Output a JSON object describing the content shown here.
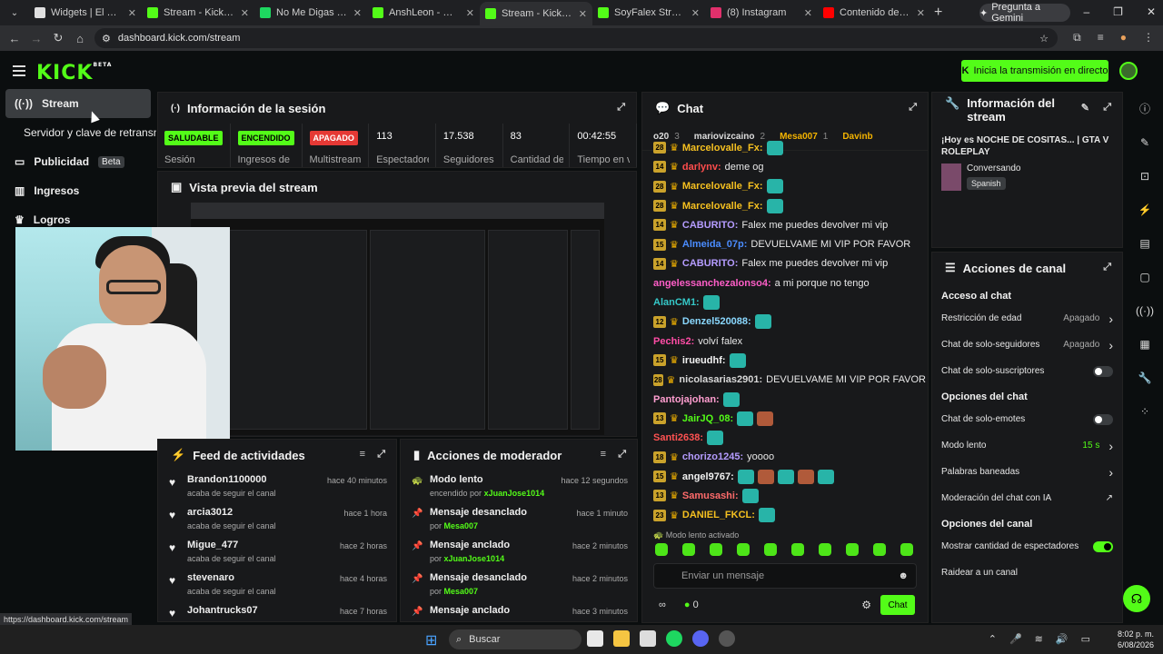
{
  "browser": {
    "tabs": [
      {
        "title": "Widgets | El mejor so",
        "color": "#e0e0e0"
      },
      {
        "title": "Stream - Kick Dashbo",
        "color": "#53fc18"
      },
      {
        "title": "No Me Digas Qu",
        "color": "#1ed760"
      },
      {
        "title": "AnshLeon - Watch cli",
        "color": "#53fc18"
      },
      {
        "title": "Stream - Kick Dashbo",
        "color": "#53fc18",
        "active": true
      },
      {
        "title": "SoyFalex Stream - W",
        "color": "#53fc18"
      },
      {
        "title": "(8) Instagram",
        "color": "#e1306c"
      },
      {
        "title": "Contenido del canal",
        "color": "#ff0000"
      }
    ],
    "gemini_label": "Pregunta a Gemini",
    "url": "dashboard.kick.com/stream"
  },
  "header": {
    "logo": "KICK",
    "logo_tag": "BETA",
    "cta_label": "Inicia la transmisión en directo"
  },
  "sidebar": {
    "items": [
      {
        "label": "Stream",
        "icon": "broadcast-icon"
      },
      {
        "label": "Servidor y clave de retransn",
        "icon": ""
      },
      {
        "label": "Publicidad",
        "icon": "ads-icon",
        "badge": "Beta"
      },
      {
        "label": "Ingresos",
        "icon": "revenue-icon"
      },
      {
        "label": "Logros",
        "icon": "trophy-icon"
      }
    ]
  },
  "session": {
    "title": "Información de la sesión",
    "stats": [
      {
        "value": "SALUDABLE",
        "label": "Sesión",
        "pill": "#53fc18"
      },
      {
        "value": "ENCENDIDO",
        "label": "Ingresos de",
        "pill": "#53fc18"
      },
      {
        "value": "APAGADO",
        "label": "Multistream",
        "pill": "#e53935"
      },
      {
        "value": "113",
        "label": "Espectadores"
      },
      {
        "value": "17.538",
        "label": "Seguidores"
      },
      {
        "value": "83",
        "label": "Cantidad de suscripciones"
      },
      {
        "value": "00:42:55",
        "label": "Tiempo en vivo"
      }
    ]
  },
  "preview": {
    "title": "Vista previa del stream"
  },
  "feed": {
    "title": "Feed de actividades",
    "items": [
      {
        "name": "Brandon1100000",
        "sub": "acaba de seguir el canal",
        "time": "hace 40 minutos"
      },
      {
        "name": "arcia3012",
        "sub": "acaba de seguir el canal",
        "time": "hace 1 hora"
      },
      {
        "name": "Migue_477",
        "sub": "acaba de seguir el canal",
        "time": "hace 2 horas"
      },
      {
        "name": "stevenaro",
        "sub": "acaba de seguir el canal",
        "time": "hace 4 horas"
      },
      {
        "name": "Johantrucks07",
        "sub": "",
        "time": "hace 7 horas"
      }
    ]
  },
  "mod": {
    "title": "Acciones de moderador",
    "items": [
      {
        "action": "Modo lento",
        "prefix": "encendido por",
        "user": "xJuanJose1014",
        "time": "hace 12 segundos"
      },
      {
        "action": "Mensaje desanclado",
        "prefix": "por",
        "user": "Mesa007",
        "time": "hace 1 minuto"
      },
      {
        "action": "Mensaje anclado",
        "prefix": "por",
        "user": "xJuanJose1014",
        "time": "hace 2 minutos"
      },
      {
        "action": "Mensaje desanclado",
        "prefix": "por",
        "user": "Mesa007",
        "time": "hace 2 minutos"
      },
      {
        "action": "Mensaje anclado",
        "prefix": "",
        "user": "",
        "time": "hace 3 minutos"
      }
    ]
  },
  "chat": {
    "title": "Chat",
    "top_users": [
      {
        "name": "o20",
        "count": "3"
      },
      {
        "name": "mariovizcaino",
        "count": "2"
      },
      {
        "name": "Mesa007",
        "count": "1"
      },
      {
        "name": "Davinb",
        "count": ""
      }
    ],
    "messages": [
      {
        "badge": "28",
        "user": "Marcelovalle_Fx:",
        "color": "#f5c020",
        "text": "",
        "emotes": 1
      },
      {
        "badge": "14",
        "user": "darlynv:",
        "color": "#ff4d4d",
        "text": "deme og",
        "emotes": 0
      },
      {
        "badge": "28",
        "user": "Marcelovalle_Fx:",
        "color": "#f5c020",
        "text": "",
        "emotes": 1
      },
      {
        "badge": "28",
        "user": "Marcelovalle_Fx:",
        "color": "#f5c020",
        "text": "",
        "emotes": 1
      },
      {
        "badge": "14",
        "user": "CABURITO:",
        "color": "#b59cff",
        "text": "Falex me puedes devolver mi vip",
        "emotes": 0
      },
      {
        "badge": "15",
        "user": "Almeida_07p:",
        "color": "#4a8cff",
        "text": "DEVUELVAME MI VIP POR FAVOR",
        "emotes": 0
      },
      {
        "badge": "14",
        "user": "CABURITO:",
        "color": "#b59cff",
        "text": "Falex me puedes devolver mi vip",
        "emotes": 0
      },
      {
        "badge": "",
        "user": "angelessanchezalonso4:",
        "color": "#ff5ec8",
        "text": "a mi porque no tengo",
        "emotes": 0
      },
      {
        "badge": "",
        "user": "AlanCM1:",
        "color": "#35c8c8",
        "text": "",
        "emotes": 1
      },
      {
        "badge": "12",
        "user": "Denzel520088:",
        "color": "#8ad8ff",
        "text": "",
        "emotes": 1
      },
      {
        "badge": "",
        "user": "Pechis2:",
        "color": "#ff4da6",
        "text": "volví falex",
        "emotes": 0
      },
      {
        "badge": "15",
        "user": "irueudhf:",
        "color": "#f2f2f2",
        "text": "",
        "emotes": 1
      },
      {
        "badge": "28",
        "user": "nicolasarias2901:",
        "color": "#d8d8d8",
        "text": "DEVUELVAME MI VIP POR FAVOR",
        "emotes": 0
      },
      {
        "badge": "",
        "user": "Pantojajohan:",
        "color": "#ff9ed0",
        "text": "",
        "emotes": 1
      },
      {
        "badge": "13",
        "user": "JairJQ_08:",
        "color": "#53fc18",
        "text": "",
        "emotes": 2
      },
      {
        "badge": "",
        "user": "Santi2638:",
        "color": "#ff5252",
        "text": "",
        "emotes": 1
      },
      {
        "badge": "18",
        "user": "chorizo1245:",
        "color": "#b59cff",
        "text": "yoooo",
        "emotes": 0
      },
      {
        "badge": "15",
        "user": "angel9767:",
        "color": "#f2f2f2",
        "text": "",
        "emotes": 5
      },
      {
        "badge": "13",
        "user": "Samusashi:",
        "color": "#ff6b6b",
        "text": "",
        "emotes": 1
      },
      {
        "badge": "23",
        "user": "DANIEL_FKCL:",
        "color": "#f5c020",
        "text": "",
        "emotes": 1
      }
    ],
    "slow_mode": "Modo lento activado",
    "input_placeholder": "Enviar un mensaje",
    "points": "0",
    "send_label": "Chat"
  },
  "stream_info": {
    "title": "Información del stream",
    "stream_title": "¡Hoy es NOCHE DE COSITAS... | GTA V ROLEPLAY",
    "category": "Conversando",
    "language": "Spanish"
  },
  "channel": {
    "title": "Acciones de canal",
    "sections": [
      {
        "heading": "Acceso al chat",
        "rows": [
          {
            "label": "Restricción de edad",
            "value": "Apagado",
            "type": "chevron"
          },
          {
            "label": "Chat de solo-seguidores",
            "value": "Apagado",
            "type": "chevron"
          },
          {
            "label": "Chat de solo-suscriptores",
            "value": "",
            "type": "toggle-off"
          }
        ]
      },
      {
        "heading": "Opciones del chat",
        "rows": [
          {
            "label": "Chat de solo-emotes",
            "value": "",
            "type": "toggle-off"
          },
          {
            "label": "Modo lento",
            "value": "15 s",
            "type": "chevron-green"
          },
          {
            "label": "Palabras baneadas",
            "value": "",
            "type": "chevron"
          },
          {
            "label": "Moderación del chat con IA",
            "value": "",
            "type": "external"
          }
        ]
      },
      {
        "heading": "Opciones del canal",
        "rows": [
          {
            "label": "Mostrar cantidad de espectadores",
            "value": "",
            "type": "toggle-on"
          },
          {
            "label": "Raidear a un canal",
            "value": "",
            "type": "none"
          }
        ]
      }
    ]
  },
  "status_url": "https://dashboard.kick.com/stream",
  "taskbar": {
    "search": "Buscar",
    "time": "8:02 p. m.",
    "date": "6/08/2026"
  }
}
